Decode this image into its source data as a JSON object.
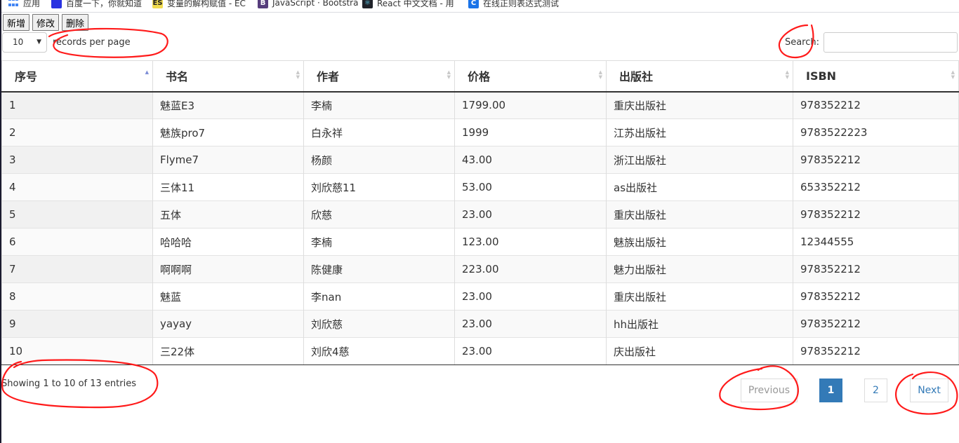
{
  "bookmarks": [
    {
      "icon": "apps-icon",
      "label": "应用"
    },
    {
      "icon": "baidu-icon",
      "label": "百度一下，你就知道"
    },
    {
      "icon": "es-icon",
      "badge": "ES",
      "label": "变量的解构赋值 - EC"
    },
    {
      "icon": "bootstrap-icon",
      "badge": "B",
      "label": "JavaScript · Bootstra"
    },
    {
      "icon": "react-icon",
      "badge": "⚛",
      "label": "React 中文文档 - 用"
    },
    {
      "icon": "c-icon",
      "badge": "C",
      "label": "在线正则表达式测试"
    }
  ],
  "toolbar": {
    "add": "新增",
    "edit": "修改",
    "delete": "删除"
  },
  "length": {
    "value": "10",
    "label": "records per page"
  },
  "search": {
    "label": "Search:",
    "value": "",
    "placeholder": ""
  },
  "table": {
    "columns": [
      "序号",
      "书名",
      "作者",
      "价格",
      "出版社",
      "ISBN"
    ],
    "sorted_column": "序号",
    "sort_direction": "asc",
    "rows": [
      [
        "1",
        "魅蓝E3",
        "李楠",
        "1799.00",
        "重庆出版社",
        "978352212"
      ],
      [
        "2",
        "魅族pro7",
        "白永祥",
        "1999",
        "江苏出版社",
        "9783522223"
      ],
      [
        "3",
        "Flyme7",
        "杨颜",
        "43.00",
        "浙江出版社",
        "978352212"
      ],
      [
        "4",
        "三体11",
        "刘欣慈11",
        "53.00",
        "as出版社",
        "653352212"
      ],
      [
        "5",
        "五体",
        "欣慈",
        "23.00",
        "重庆出版社",
        "978352212"
      ],
      [
        "6",
        "哈哈哈",
        "李楠",
        "123.00",
        "魅族出版社",
        "12344555"
      ],
      [
        "7",
        "啊啊啊",
        "陈健康",
        "223.00",
        "魅力出版社",
        "978352212"
      ],
      [
        "8",
        "魅蓝",
        "李nan",
        "23.00",
        "重庆出版社",
        "978352212"
      ],
      [
        "9",
        "yayay",
        "刘欣慈",
        "23.00",
        "hh出版社",
        "978352212"
      ],
      [
        "10",
        "三22体",
        "刘欣4慈",
        "23.00",
        "庆出版社",
        "978352212"
      ]
    ]
  },
  "info": "Showing 1 to 10 of 13 entries",
  "pagination": {
    "previous": "Previous",
    "pages": [
      "1",
      "2"
    ],
    "current": "1",
    "next": "Next"
  },
  "colors": {
    "accent": "#337ab7",
    "annotation": "#ff0000"
  }
}
